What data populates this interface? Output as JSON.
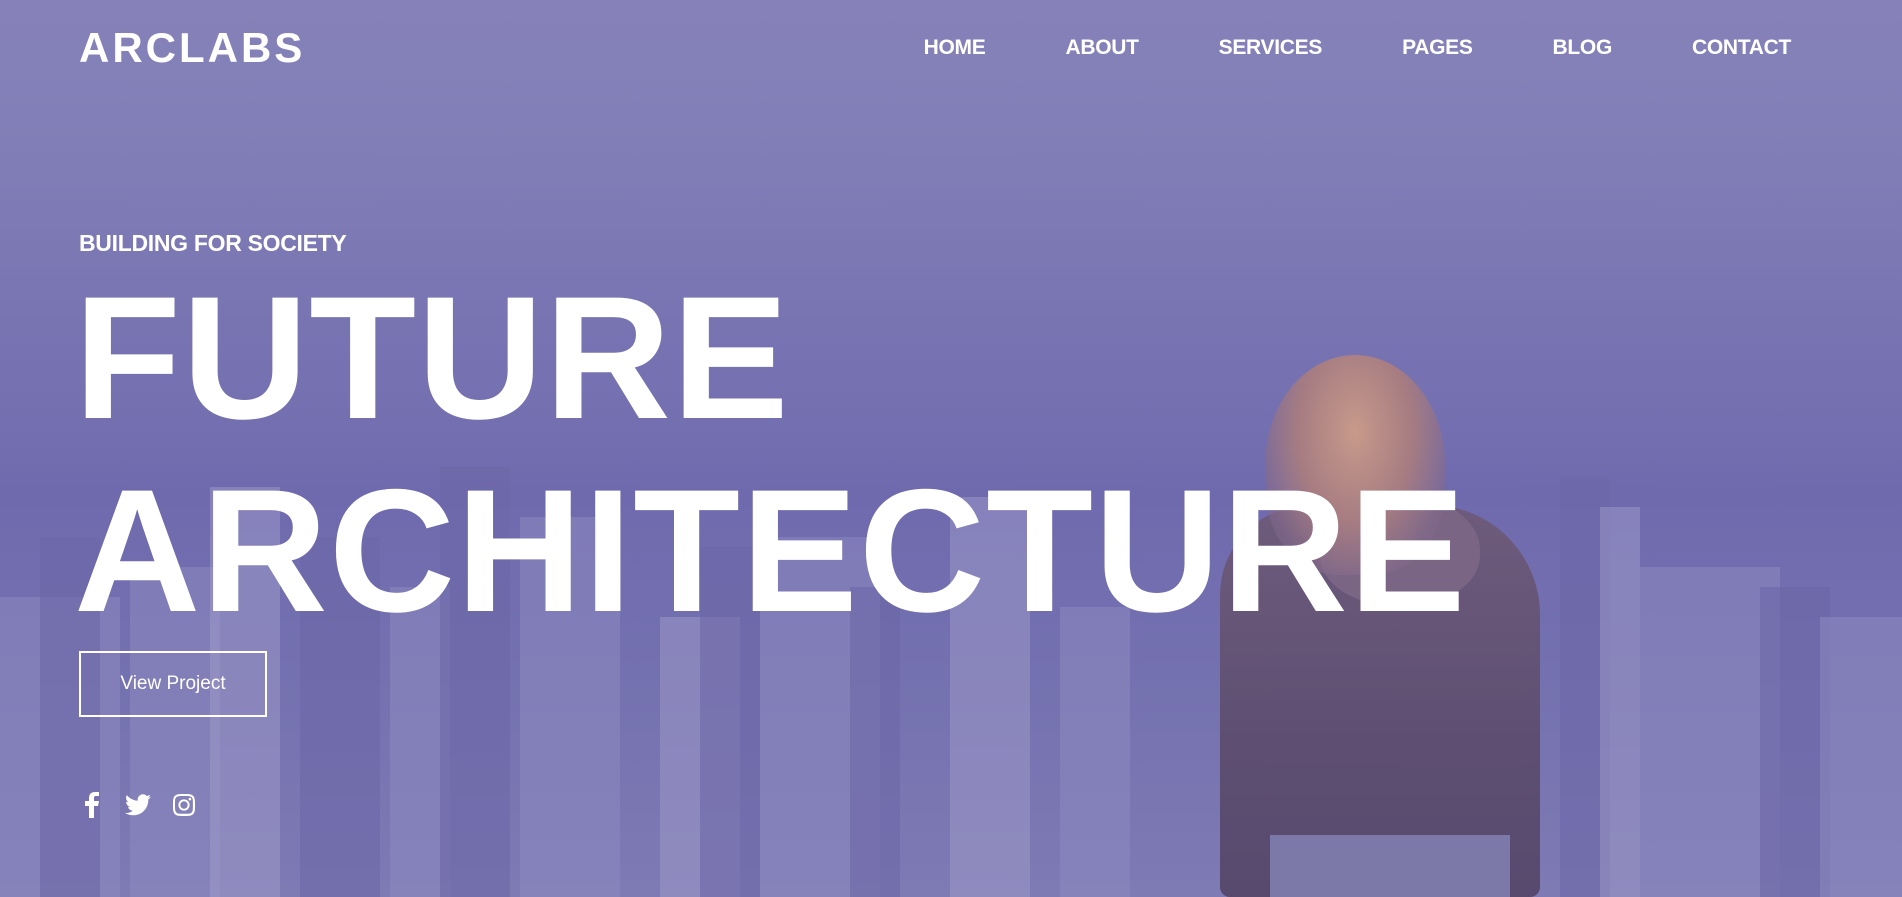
{
  "brand": {
    "logo_text": "ARCLABS"
  },
  "nav": {
    "items": [
      {
        "label": "HOME"
      },
      {
        "label": "ABOUT"
      },
      {
        "label": "SERVICES"
      },
      {
        "label": "PAGES"
      },
      {
        "label": "BLOG"
      },
      {
        "label": "CONTACT"
      }
    ]
  },
  "hero": {
    "eyebrow": "BUILDING FOR SOCIETY",
    "headline_line1": "FUTURE",
    "headline_line2": "ARCHITECTURE",
    "cta_label": "View Project",
    "overlay_color": "#7d79b6"
  },
  "social": {
    "icons": [
      "facebook-icon",
      "twitter-icon",
      "instagram-icon"
    ]
  }
}
